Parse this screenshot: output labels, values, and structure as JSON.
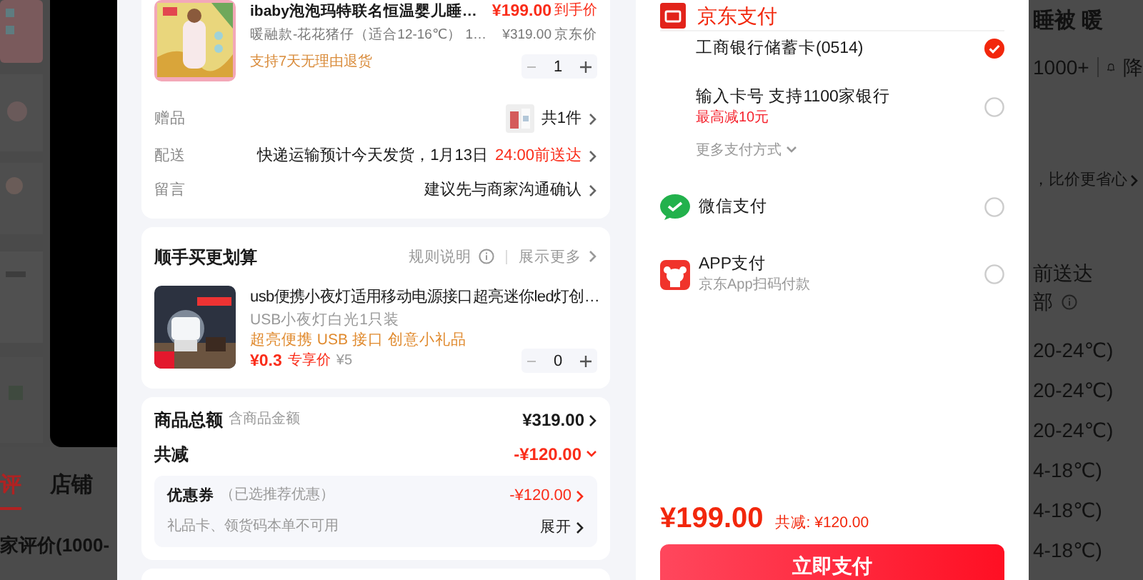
{
  "background_page": {
    "left": {
      "tabs": [
        {
          "label": "评",
          "selected": true
        },
        {
          "label": "店铺",
          "selected": false
        }
      ],
      "section_title": "家评价(1000-"
    },
    "right": {
      "title": "睡被 暖",
      "review_count": "1000+",
      "price_alert": "降",
      "compare_link": "，比价更省心",
      "delivery": "前送达",
      "stock_note": "部",
      "sizes": [
        "20-24℃)",
        "20-24℃)",
        "20-24℃)",
        "4-18℃)",
        "4-18℃)",
        "4-18℃)"
      ]
    }
  },
  "order": {
    "product": {
      "title": "ibaby泡泡玛特联名恒温婴儿睡…",
      "spec": "暖融款-花花猪仔（适合12-16℃） 1…",
      "policy": "支持7天无理由退货",
      "price": "¥199.00",
      "price_label": "到手价",
      "list_price": "¥319.00",
      "list_price_label": "京东价",
      "quantity": "1"
    },
    "details": [
      {
        "kind": "gift",
        "label": "赠品",
        "value": "共1件"
      },
      {
        "kind": "delivery",
        "label": "配送",
        "value": "快递运输预计今天发货，1月13日",
        "highlight": "24:00前送达"
      },
      {
        "kind": "note",
        "label": "留言",
        "value": "建议先与商家沟通确认"
      }
    ],
    "addon": {
      "title": "顺手买更划算",
      "rules": "规则说明",
      "more": "展示更多",
      "item": {
        "title": "usb便携小夜灯适用移动电源接口超亮迷你led灯创…",
        "spec": "USB小夜灯白光1只装",
        "tags": "超亮便携 USB 接口 创意小礼品",
        "price": "¥0.3",
        "price_label": "专享价",
        "original_price": "¥5",
        "quantity": "0"
      }
    },
    "summary": {
      "total_label": "商品总额",
      "total_note": "含商品金额",
      "total": "¥319.00",
      "discount_label": "共减",
      "discount": "-¥120.00",
      "expanded": true,
      "coupon": {
        "label": "优惠券",
        "note": "（已选推荐优惠）",
        "value": "-¥120.00",
        "gift_card_note": "礼品卡、领货码本单不可用",
        "toggle": "展开"
      }
    }
  },
  "payment": {
    "title": "京东支付",
    "options": [
      {
        "kind": "bank",
        "label": "工商银行储蓄卡(0514)",
        "selected": true
      },
      {
        "kind": "bank",
        "label": "输入卡号 支持1100家银行",
        "promo": "最高减10元",
        "selected": false
      }
    ],
    "more": "更多支付方式",
    "other_options": [
      {
        "kind": "wechat",
        "label": "微信支付",
        "selected": false
      },
      {
        "kind": "app",
        "label": "APP支付",
        "sub": "京东App扫码付款",
        "selected": false
      }
    ],
    "total": "¥199.00",
    "discount": "共减: ¥120.00",
    "pay_button": "立即支付"
  }
}
